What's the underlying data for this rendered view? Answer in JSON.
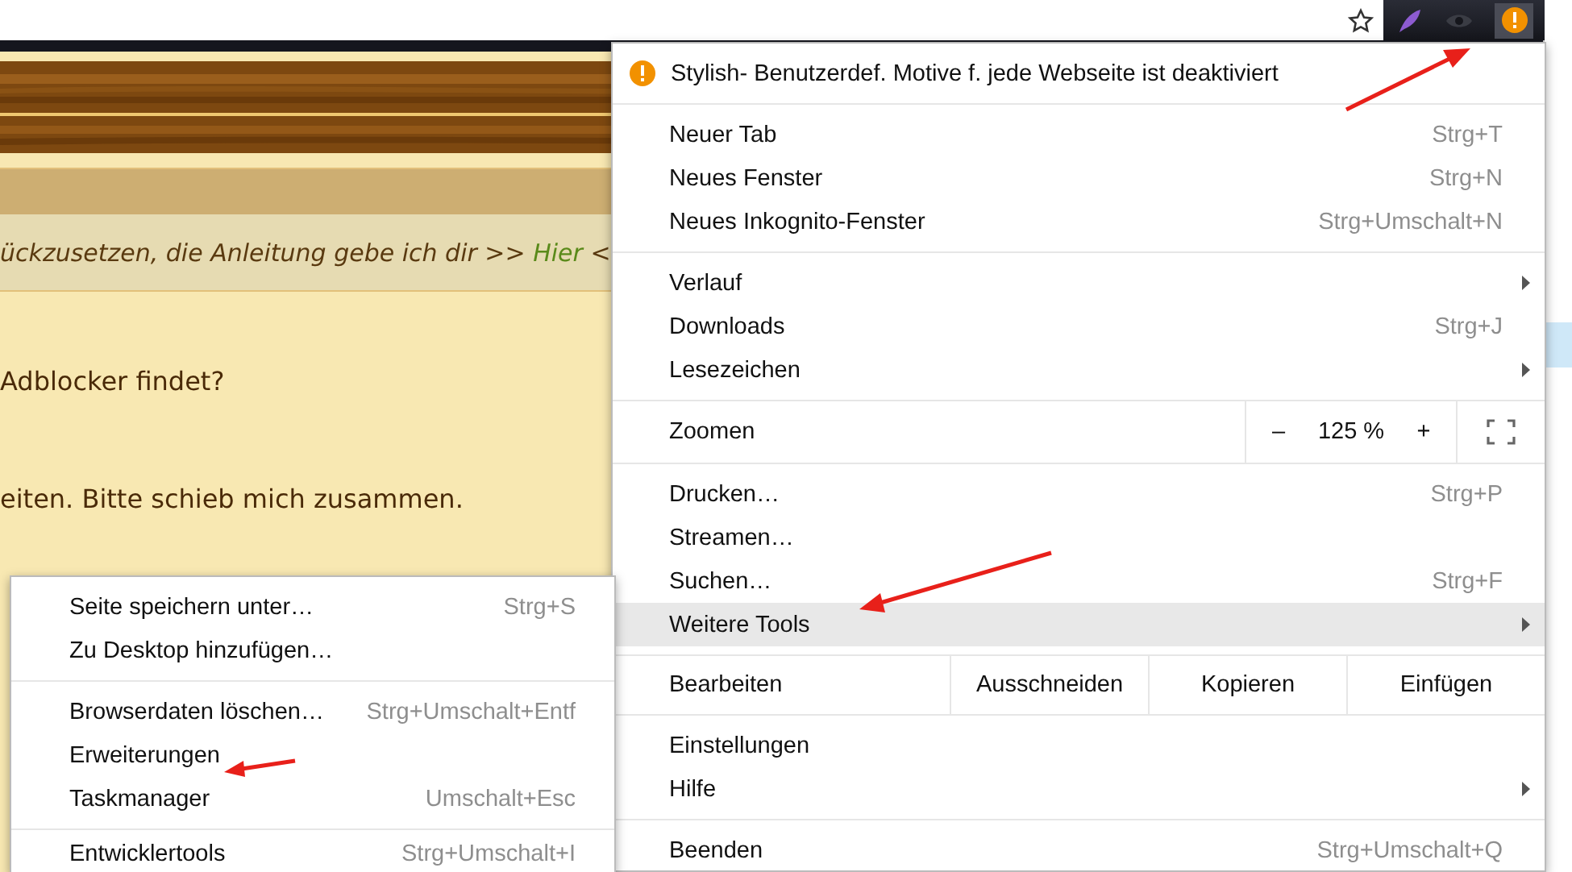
{
  "page": {
    "notice": {
      "text": "ückzusetzen, die Anleitung gebe ich dir >> ",
      "link": "Hier",
      "after": " <"
    },
    "paragraphs": [
      "Adblocker findet?",
      "eiten. Bitte schieb mich zusammen."
    ]
  },
  "menu": {
    "warning": "Stylish- Benutzerdef. Motive f. jede Webseite ist deaktiviert",
    "sections": [
      [
        {
          "kind": "item",
          "label": "Neuer Tab",
          "shortcut": "Strg+T",
          "submenu": false,
          "selected": false
        },
        {
          "kind": "item",
          "label": "Neues Fenster",
          "shortcut": "Strg+N",
          "submenu": false,
          "selected": false
        },
        {
          "kind": "item",
          "label": "Neues Inkognito-Fenster",
          "shortcut": "Strg+Umschalt+N",
          "submenu": false,
          "selected": false
        }
      ],
      [
        {
          "kind": "item",
          "label": "Verlauf",
          "submenu": true,
          "selected": false
        },
        {
          "kind": "item",
          "label": "Downloads",
          "shortcut": "Strg+J",
          "submenu": false,
          "selected": false
        },
        {
          "kind": "item",
          "label": "Lesezeichen",
          "submenu": true,
          "selected": false
        }
      ],
      [
        {
          "kind": "zoom",
          "label": "Zoomen",
          "minus": "–",
          "value": "125 %",
          "plus": "+"
        }
      ],
      [
        {
          "kind": "item",
          "label": "Drucken…",
          "shortcut": "Strg+P",
          "submenu": false,
          "selected": false
        },
        {
          "kind": "item",
          "label": "Streamen…",
          "submenu": false,
          "selected": false
        },
        {
          "kind": "item",
          "label": "Suchen…",
          "shortcut": "Strg+F",
          "submenu": false,
          "selected": false
        },
        {
          "kind": "item",
          "label": "Weitere Tools",
          "submenu": true,
          "selected": true
        }
      ],
      [
        {
          "kind": "edit",
          "label": "Bearbeiten",
          "buttons": [
            "Ausschneiden",
            "Kopieren",
            "Einfügen"
          ]
        }
      ],
      [
        {
          "kind": "item",
          "label": "Einstellungen",
          "submenu": false,
          "selected": false
        },
        {
          "kind": "item",
          "label": "Hilfe",
          "submenu": true,
          "selected": false
        }
      ],
      [
        {
          "kind": "item",
          "label": "Beenden",
          "shortcut": "Strg+Umschalt+Q",
          "submenu": false,
          "selected": false
        }
      ]
    ]
  },
  "submenu": {
    "sections": [
      [
        {
          "kind": "item",
          "label": "Seite speichern unter…",
          "shortcut": "Strg+S",
          "submenu": false,
          "selected": false
        },
        {
          "kind": "item",
          "label": "Zu Desktop hinzufügen…",
          "submenu": false,
          "selected": false
        }
      ],
      [
        {
          "kind": "item",
          "label": "Browserdaten löschen…",
          "shortcut": "Strg+Umschalt+Entf",
          "submenu": false,
          "selected": false
        },
        {
          "kind": "item",
          "label": "Erweiterungen",
          "submenu": false,
          "selected": false
        },
        {
          "kind": "item",
          "label": "Taskmanager",
          "shortcut": "Umschalt+Esc",
          "submenu": false,
          "selected": false
        }
      ],
      [
        {
          "kind": "item",
          "label": "Entwicklertools",
          "shortcut": "Strg+Umschalt+I",
          "submenu": false,
          "selected": false
        }
      ]
    ]
  }
}
